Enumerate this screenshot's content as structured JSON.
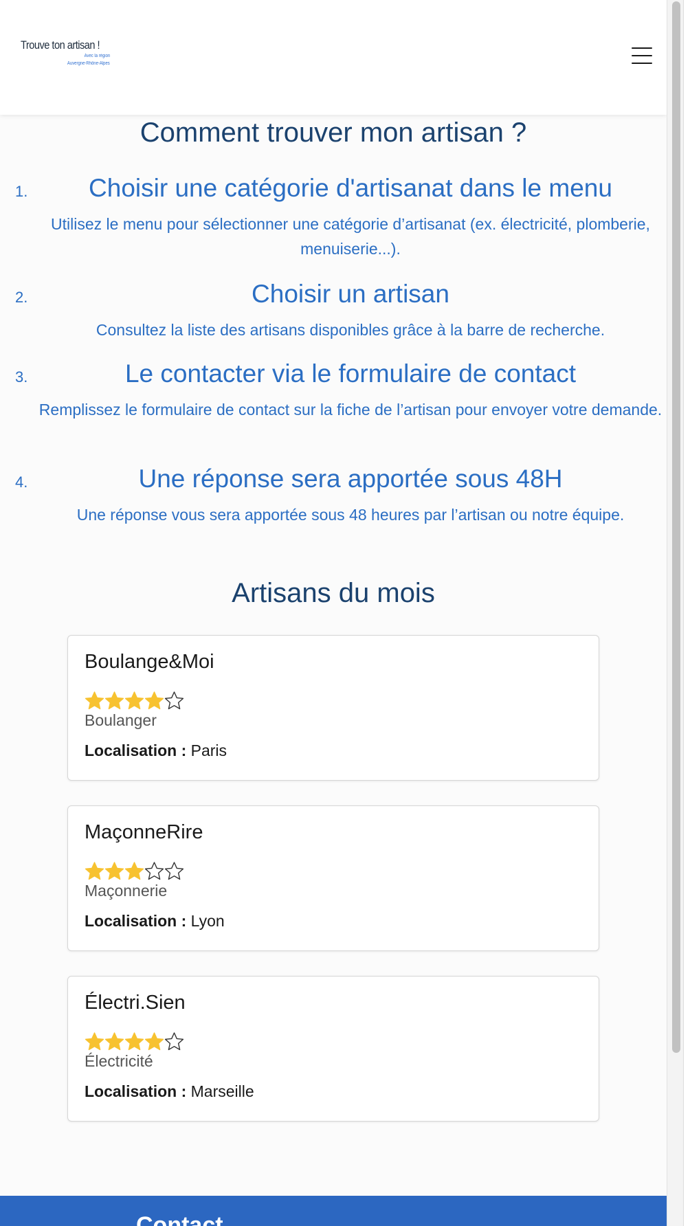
{
  "header": {
    "logo": {
      "title": "Trouve ton artisan !",
      "line1": "Avec la région",
      "line2": "Auvergne-Rhône-Alpes"
    },
    "menu_icon": "hamburger-menu-icon"
  },
  "howto": {
    "title": "Comment trouver mon artisan ?",
    "steps": [
      {
        "num": "1.",
        "title": "Choisir une catégorie d'artisanat dans le menu",
        "desc": "Utilisez le menu pour sélectionner une catégorie d’artisanat (ex. électricité, plomberie, menuiserie...)."
      },
      {
        "num": "2.",
        "title": "Choisir un artisan",
        "desc": "Consultez la liste des artisans disponibles grâce à la barre de recherche."
      },
      {
        "num": "3.",
        "title": "Le contacter via le formulaire de contact",
        "desc": "Remplissez le formulaire de contact sur la fiche de l’artisan pour envoyer votre demande."
      },
      {
        "num": "4.",
        "title": "Une réponse sera apportée sous 48H",
        "desc": "Une réponse vous sera apportée sous 48 heures par l’artisan ou notre équipe."
      }
    ]
  },
  "artisans": {
    "title": "Artisans du mois",
    "location_label": "Localisation :",
    "items": [
      {
        "name": "Boulange&Moi",
        "rating": 4,
        "max_rating": 5,
        "category": "Boulanger",
        "location": "Paris"
      },
      {
        "name": "MaçonneRire",
        "rating": 3,
        "max_rating": 5,
        "category": "Maçonnerie",
        "location": "Lyon"
      },
      {
        "name": "Électri.Sien",
        "rating": 4,
        "max_rating": 5,
        "category": "Électricité",
        "location": "Marseille"
      }
    ]
  },
  "footer": {
    "title": "Contact"
  },
  "colors": {
    "heading_dark_blue": "#1b426e",
    "accent_blue": "#2b6ec3",
    "footer_blue": "#2c67c1",
    "star_filled": "#f7c230"
  }
}
